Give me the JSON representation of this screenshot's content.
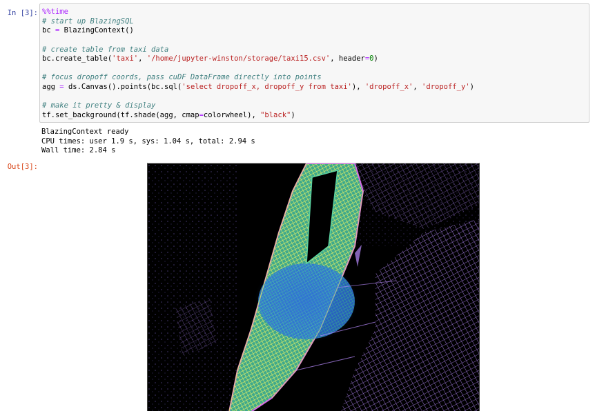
{
  "prompts": {
    "input": "In [3]:",
    "output": "Out[3]:"
  },
  "code": {
    "magic": "%%time",
    "comment_1": "# start up BlazingSQL",
    "line_2": {
      "var": "bc",
      "op": "=",
      "rest": "BlazingContext()"
    },
    "comment_2": "# create table from taxi data",
    "line_4": {
      "start": "bc.create_table(",
      "arg1": "'taxi'",
      "sep": ", ",
      "arg2": "'/home/jupyter-winston/storage/taxi15.csv'",
      "mid": ", header",
      "op": "=",
      "num": "0",
      "end": ")"
    },
    "comment_3": "# focus dropoff coords, pass cuDF DataFrame directly into points",
    "line_6": {
      "var": "agg",
      "op": "=",
      "start": "ds.Canvas().points(bc.sql(",
      "sql": "'select dropoff_x, dropoff_y from taxi'",
      "sep1": "), ",
      "x": "'dropoff_x'",
      "sep2": ", ",
      "y": "'dropoff_y'",
      "end": ")"
    },
    "comment_4": "# make it pretty & display",
    "line_8": {
      "start": "tf.set_background(tf.shade(agg, cmap",
      "op": "=",
      "mid": "colorwheel), ",
      "str": "\"black\"",
      "end": ")"
    }
  },
  "stdout": [
    "BlazingContext ready",
    "CPU times: user 1.9 s, sys: 1.04 s, total: 2.94 s",
    "Wall time: 2.84 s"
  ],
  "output_image": {
    "description_icon": "nyc-taxi-dropoff-map",
    "background": "#000000",
    "colors": [
      "#b98cff",
      "#5ad2a0",
      "#e8f060",
      "#2e6fd8",
      "#d46be8"
    ]
  }
}
